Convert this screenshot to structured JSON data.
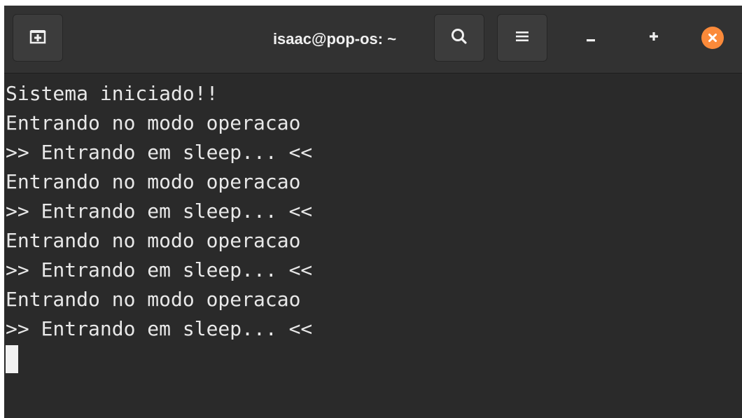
{
  "window": {
    "title": "isaac@pop-os: ~"
  },
  "icons": {
    "new_tab": "new-tab-icon",
    "search": "search-icon",
    "menu": "hamburger-menu-icon",
    "minimize": "minimize-icon",
    "maximize": "maximize-icon",
    "close": "close-icon"
  },
  "colors": {
    "window_bg": "#2a2a2a",
    "titlebar_bg": "#323232",
    "text": "#e8e8e8",
    "close_accent": "#fb8a3a"
  },
  "terminal": {
    "lines": [
      "Sistema iniciado!!",
      "Entrando no modo operacao",
      ">> Entrando em sleep... <<",
      "Entrando no modo operacao",
      ">> Entrando em sleep... <<",
      "Entrando no modo operacao",
      ">> Entrando em sleep... <<",
      "Entrando no modo operacao",
      ">> Entrando em sleep... <<"
    ]
  }
}
